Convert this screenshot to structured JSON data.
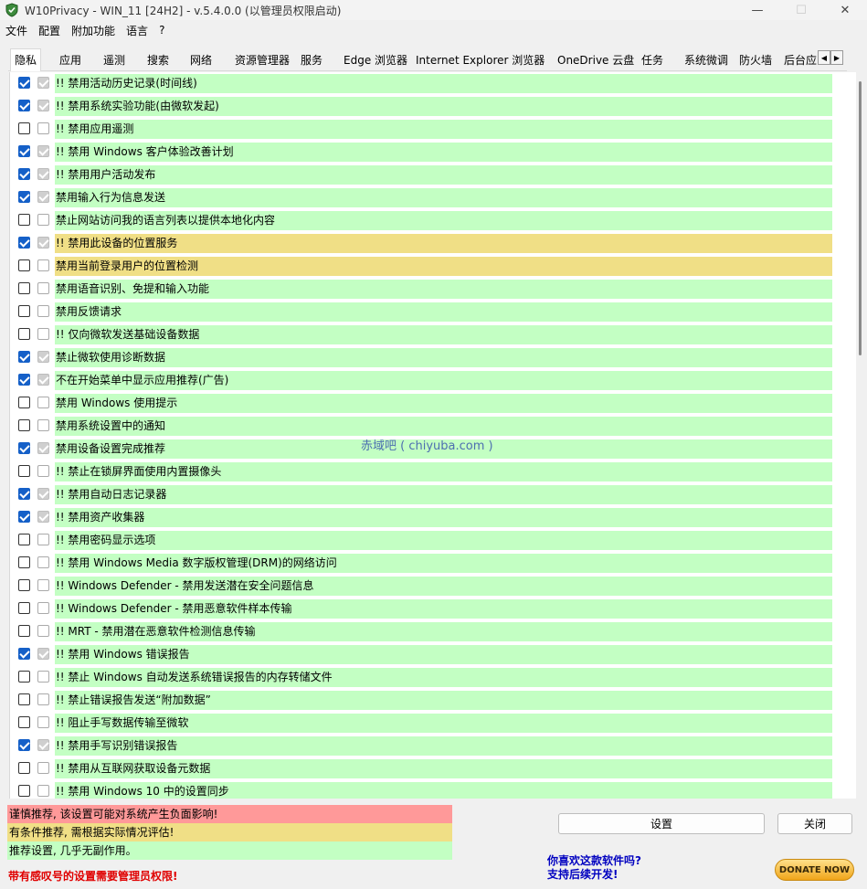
{
  "window": {
    "title": "W10Privacy - WIN_11 [24H2]  - v.5.4.0.0 (以管理员权限启动)",
    "minimize": "—",
    "maximize": "☐",
    "close": "✕"
  },
  "menu": [
    "文件",
    "配置",
    "附加功能",
    "语言",
    "?"
  ],
  "tabs": [
    "隐私",
    "应用",
    "遥测",
    "搜索",
    "网络",
    "资源管理器",
    "服务",
    "Edge 浏览器",
    "Internet Explorer 浏览器",
    "OneDrive 云盘",
    "任务",
    "系统微调",
    "防火墙",
    "后台应"
  ],
  "tab_scroll": {
    "left": "◀",
    "right": "▶"
  },
  "items": [
    {
      "label": "!! 禁用活动历史记录(时间线)",
      "checked": true,
      "default": true,
      "color": "green"
    },
    {
      "label": "!! 禁用系统实验功能(由微软发起)",
      "checked": true,
      "default": true,
      "color": "green"
    },
    {
      "label": "!! 禁用应用遥测",
      "checked": false,
      "default": false,
      "color": "green"
    },
    {
      "label": "!! 禁用 Windows 客户体验改善计划",
      "checked": true,
      "default": true,
      "color": "green"
    },
    {
      "label": "!! 禁用用户活动发布",
      "checked": true,
      "default": true,
      "color": "green"
    },
    {
      "label": "禁用输入行为信息发送",
      "checked": true,
      "default": true,
      "color": "green"
    },
    {
      "label": "禁止网站访问我的语言列表以提供本地化内容",
      "checked": false,
      "default": false,
      "color": "green"
    },
    {
      "label": "!! 禁用此设备的位置服务",
      "checked": true,
      "default": true,
      "color": "yellow"
    },
    {
      "label": "禁用当前登录用户的位置检测",
      "checked": false,
      "default": false,
      "color": "yellow"
    },
    {
      "label": "禁用语音识别、免提和输入功能",
      "checked": false,
      "default": false,
      "color": "green"
    },
    {
      "label": "禁用反馈请求",
      "checked": false,
      "default": false,
      "color": "green"
    },
    {
      "label": "!! 仅向微软发送基础设备数据",
      "checked": false,
      "default": false,
      "color": "green"
    },
    {
      "label": "禁止微软使用诊断数据",
      "checked": true,
      "default": true,
      "color": "green"
    },
    {
      "label": "不在开始菜单中显示应用推荐(广告)",
      "checked": true,
      "default": true,
      "color": "green"
    },
    {
      "label": "禁用 Windows 使用提示",
      "checked": false,
      "default": false,
      "color": "green"
    },
    {
      "label": "禁用系统设置中的通知",
      "checked": false,
      "default": false,
      "color": "green"
    },
    {
      "label": "禁用设备设置完成推荐",
      "checked": true,
      "default": true,
      "color": "green"
    },
    {
      "label": "!! 禁止在锁屏界面使用内置摄像头",
      "checked": false,
      "default": false,
      "color": "green"
    },
    {
      "label": "!! 禁用自动日志记录器",
      "checked": true,
      "default": true,
      "color": "green"
    },
    {
      "label": "!! 禁用资产收集器",
      "checked": true,
      "default": true,
      "color": "green"
    },
    {
      "label": "!! 禁用密码显示选项",
      "checked": false,
      "default": false,
      "color": "green"
    },
    {
      "label": "!! 禁用 Windows Media 数字版权管理(DRM)的网络访问",
      "checked": false,
      "default": false,
      "color": "green"
    },
    {
      "label": "!! Windows Defender - 禁用发送潜在安全问题信息",
      "checked": false,
      "default": false,
      "color": "green"
    },
    {
      "label": "!! Windows Defender - 禁用恶意软件样本传输",
      "checked": false,
      "default": false,
      "color": "green"
    },
    {
      "label": "!! MRT - 禁用潜在恶意软件检测信息传输",
      "checked": false,
      "default": false,
      "color": "green"
    },
    {
      "label": "!! 禁用 Windows 错误报告",
      "checked": true,
      "default": true,
      "color": "green"
    },
    {
      "label": "!! 禁止 Windows 自动发送系统错误报告的内存转储文件",
      "checked": false,
      "default": false,
      "color": "green"
    },
    {
      "label": "!! 禁止错误报告发送“附加数据”",
      "checked": false,
      "default": false,
      "color": "green"
    },
    {
      "label": "!! 阻止手写数据传输至微软",
      "checked": false,
      "default": false,
      "color": "green"
    },
    {
      "label": "!! 禁用手写识别错误报告",
      "checked": true,
      "default": true,
      "color": "green"
    },
    {
      "label": "!! 禁用从互联网获取设备元数据",
      "checked": false,
      "default": false,
      "color": "green"
    },
    {
      "label": "!! 禁用 Windows 10 中的设置同步",
      "checked": false,
      "default": false,
      "color": "green"
    }
  ],
  "watermark": "赤域吧 ( chiyuba.com )",
  "legend": {
    "red": "谨慎推荐, 该设置可能对系统产生负面影响!",
    "yellow": "有条件推荐, 需根据实际情况评估!",
    "green": "推荐设置, 几乎无副作用。"
  },
  "admin_note": "带有感叹号的设置需要管理员权限!",
  "buttons": {
    "set": "设置",
    "close": "关闭"
  },
  "promo": {
    "line1": "你喜欢这款软件吗?",
    "line2": "支持后续开发!"
  },
  "donate": "DONATE NOW",
  "colors": {
    "green": "#c3ffc3",
    "yellow": "#f0df86",
    "red": "#ff9999",
    "accent": "#1560c8"
  }
}
